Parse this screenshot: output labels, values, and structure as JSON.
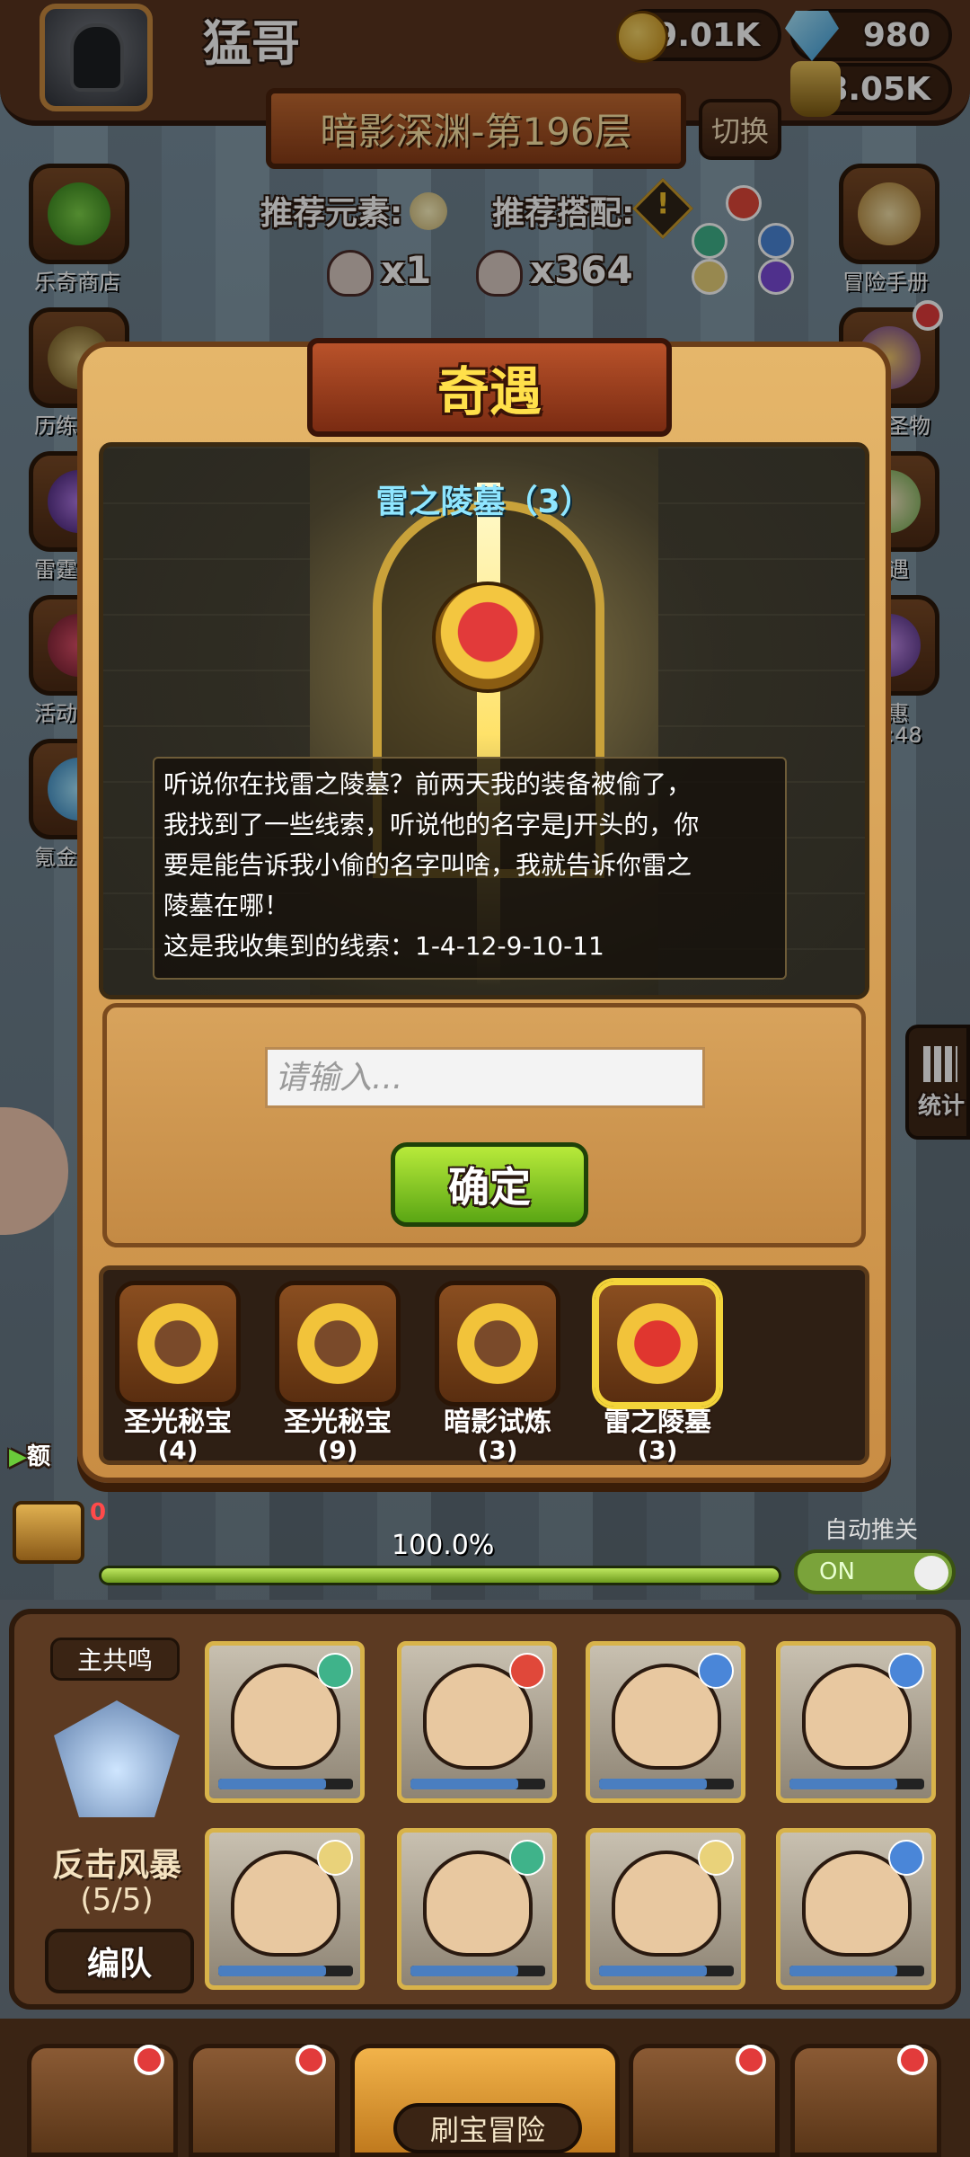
{
  "player": {
    "name": "猛哥"
  },
  "resources": {
    "coins": "39.01K",
    "gems": "980",
    "potion": "68.05K"
  },
  "stage": {
    "title": "暗影深渊-第196层",
    "switch_label": "切换"
  },
  "recommend": {
    "element_label": "推荐元素:",
    "combo_label": "推荐搭配:",
    "combo_warning": "!"
  },
  "skulls": {
    "small": "x1",
    "big": "x364"
  },
  "side_left": [
    {
      "label": "乐奇商店",
      "icon": "clover-icon"
    },
    {
      "label": "历练",
      "icon": "jar-icon"
    },
    {
      "label": "雷霆",
      "icon": "orb-icon"
    },
    {
      "label": "活动",
      "icon": "gift-icon"
    },
    {
      "label": "氪金",
      "icon": "diamond-icon"
    }
  ],
  "side_right": [
    {
      "label": "冒险手册",
      "icon": "scroll-icon"
    },
    {
      "label": "圣物",
      "icon": "chest-icon"
    },
    {
      "label": "遇",
      "icon": "list-icon"
    },
    {
      "label": "惠",
      "icon": "box-icon"
    },
    {
      "label": ":48",
      "icon": "timer"
    }
  ],
  "modal": {
    "title": "奇遇",
    "scene_title": "雷之陵墓（3）",
    "story_lines": [
      "听说你在找雷之陵墓？前两天我的装备被偷了，",
      "我找到了一些线索，听说他的名字是J开头的，你",
      "要是能告诉我小偷的名字叫啥，我就告诉你雷之",
      "陵墓在哪！",
      "这是我收集到的线索：1-4-12-9-10-11"
    ],
    "input_placeholder": "请输入...",
    "confirm_label": "确定",
    "tray": [
      {
        "name": "圣光秘宝",
        "count": "(4)",
        "active": false
      },
      {
        "name": "圣光秘宝",
        "count": "(9)",
        "active": false
      },
      {
        "name": "暗影试炼",
        "count": "(3)",
        "active": false
      },
      {
        "name": "雷之陵墓",
        "count": "(3)",
        "active": true
      }
    ]
  },
  "progress": {
    "text": "100.0%",
    "value": 1.0
  },
  "chest_count": "0",
  "quota_label": "额",
  "auto": {
    "label": "自动推关",
    "toggle": "ON"
  },
  "stats_label": "统计",
  "team": {
    "tag": "主共鸣",
    "storm_name": "反击风暴",
    "storm_count": "(5/5)",
    "edit_label": "编队",
    "heroes": [
      {
        "name": "hero-1",
        "element": "#3fb38a"
      },
      {
        "name": "hero-2",
        "element": "#e0483a"
      },
      {
        "name": "hero-3",
        "element": "#4a86d8"
      },
      {
        "name": "hero-4",
        "element": "#4a86d8"
      },
      {
        "name": "hero-5",
        "element": "#e9d27a"
      },
      {
        "name": "hero-6",
        "element": "#3fb38a"
      },
      {
        "name": "hero-7",
        "element": "#e9d27a"
      },
      {
        "name": "hero-8",
        "element": "#4a86d8"
      }
    ]
  },
  "nav": {
    "main_label": "刷宝冒险"
  }
}
